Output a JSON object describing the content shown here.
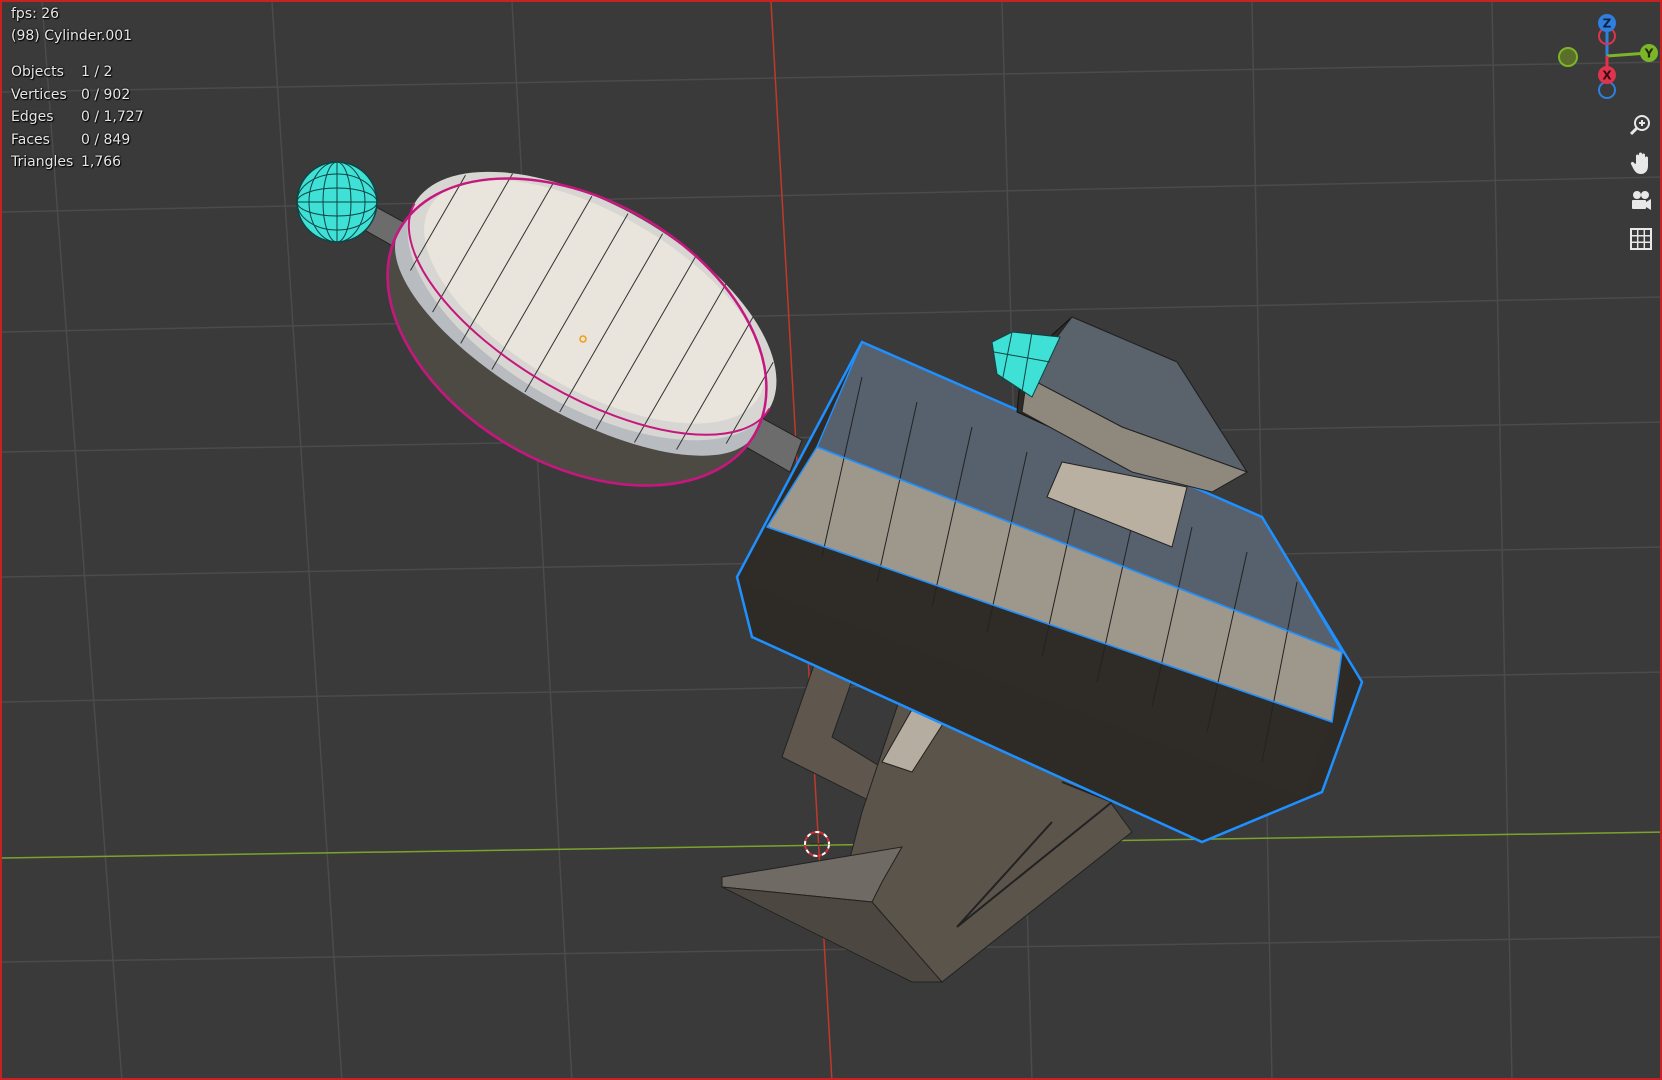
{
  "viewport": {
    "fps_text": "fps: 26",
    "object_text": "(98) Cylinder.001",
    "stats": [
      {
        "label": "Objects",
        "value": "1 / 2"
      },
      {
        "label": "Vertices",
        "value": "0 / 902"
      },
      {
        "label": "Edges",
        "value": "0 / 1,727"
      },
      {
        "label": "Faces",
        "value": "0 / 849"
      },
      {
        "label": "Triangles",
        "value": "1,766"
      }
    ]
  },
  "gizmo": {
    "z_label": "Z",
    "y_label": "Y",
    "x_label": "X",
    "colors": {
      "z": "#2f7fde",
      "y": "#7db52a",
      "x": "#e0334d"
    }
  },
  "tools": [
    {
      "icon": "zoom-icon"
    },
    {
      "icon": "hand-pan-icon"
    },
    {
      "icon": "camera-icon"
    },
    {
      "icon": "grid-view-icon"
    }
  ],
  "colors": {
    "background": "#3a3a3a",
    "grid": "#4a4a4a",
    "x_axis": "#c0392b",
    "y_axis": "#7aa32c",
    "selection_outline": "#1e90ff",
    "ellipse_outline": "#c4187e",
    "cyan_parts": "#3fe0d5",
    "border": "#c62222"
  }
}
